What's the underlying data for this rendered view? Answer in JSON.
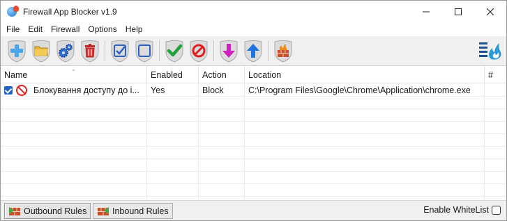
{
  "window": {
    "title": "Firewall App Blocker v1.9"
  },
  "menu": [
    "File",
    "Edit",
    "Firewall",
    "Options",
    "Help"
  ],
  "toolbar": {
    "buttons": [
      {
        "icon": "add-icon"
      },
      {
        "icon": "open-folder-icon"
      },
      {
        "icon": "settings-gears-icon"
      },
      {
        "icon": "delete-icon"
      },
      {
        "icon": "check-all-icon"
      },
      {
        "icon": "uncheck-all-icon"
      },
      {
        "icon": "enable-icon"
      },
      {
        "icon": "disable-icon"
      },
      {
        "icon": "move-down-icon"
      },
      {
        "icon": "move-up-icon"
      },
      {
        "icon": "firewall-icon"
      }
    ],
    "right_icon": "menu-flame-icon"
  },
  "columns": {
    "name": "Name",
    "enabled": "Enabled",
    "action": "Action",
    "location": "Location",
    "num": "#"
  },
  "rows": [
    {
      "checked": true,
      "icon": "block-icon",
      "name": "Блокування доступу до і...",
      "enabled": "Yes",
      "action": "Block",
      "location": "C:\\Program Files\\Google\\Chrome\\Application\\chrome.exe",
      "num": ""
    }
  ],
  "tabs": {
    "outbound": "Outbound Rules",
    "inbound": "Inbound Rules",
    "active": "outbound"
  },
  "whitelist": {
    "label": "Enable WhiteList",
    "checked": false
  },
  "colors": {
    "accent": "#1e64c8",
    "block": "#e02020",
    "enable": "#22a03a",
    "down_arrow": "#d020c0",
    "up_arrow": "#1f73e0"
  }
}
